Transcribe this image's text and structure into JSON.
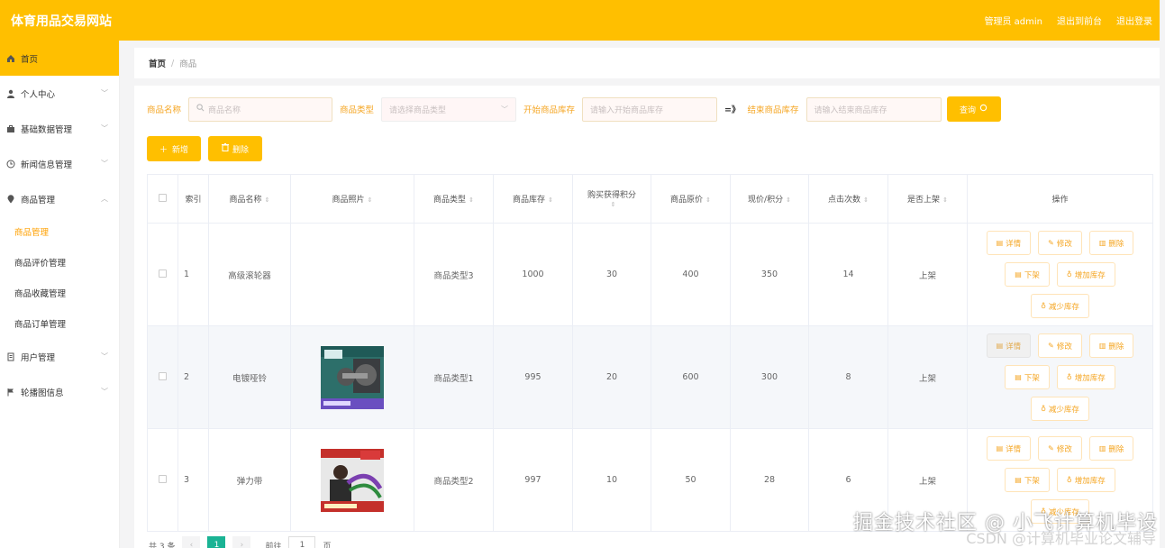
{
  "header": {
    "title": "体育用品交易网站",
    "admin_label": "管理员 admin",
    "back_label": "退出到前台",
    "logout_label": "退出登录"
  },
  "sidebar": {
    "items": [
      {
        "label": "首页",
        "icon": "home-icon"
      },
      {
        "label": "个人中心",
        "icon": "user-icon"
      },
      {
        "label": "基础数据管理",
        "icon": "briefcase-icon"
      },
      {
        "label": "新闻信息管理",
        "icon": "clock-icon"
      },
      {
        "label": "商品管理",
        "icon": "location-icon"
      },
      {
        "label": "用户管理",
        "icon": "document-icon"
      },
      {
        "label": "轮播图信息",
        "icon": "flag-icon"
      }
    ],
    "sub_items": [
      "商品管理",
      "商品评价管理",
      "商品收藏管理",
      "商品订单管理"
    ]
  },
  "breadcrumb": {
    "home": "首页",
    "sep": "/",
    "current": "商品"
  },
  "search": {
    "name_label": "商品名称",
    "name_placeholder": "商品名称",
    "type_label": "商品类型",
    "type_placeholder": "请选择商品类型",
    "stock_start_label": "开始商品库存",
    "stock_start_placeholder": "请输入开始商品库存",
    "arrow": "=》",
    "stock_end_label": "结束商品库存",
    "stock_end_placeholder": "请输入结束商品库存",
    "query_label": "查询"
  },
  "actions": {
    "add_label": "新增",
    "delete_label": "删除"
  },
  "table": {
    "headers": [
      "索引",
      "商品名称",
      "商品照片",
      "商品类型",
      "商品库存",
      "购买获得积分",
      "商品原价",
      "现价/积分",
      "点击次数",
      "是否上架",
      "操作"
    ],
    "rows": [
      {
        "index": "1",
        "name": "高级滚轮器",
        "type": "商品类型3",
        "stock": "1000",
        "points": "30",
        "orig_price": "400",
        "price": "350",
        "clicks": "14",
        "onsale": "上架"
      },
      {
        "index": "2",
        "name": "电镀哑铃",
        "type": "商品类型1",
        "stock": "995",
        "points": "20",
        "orig_price": "600",
        "price": "300",
        "clicks": "8",
        "onsale": "上架"
      },
      {
        "index": "3",
        "name": "弹力带",
        "type": "商品类型2",
        "stock": "997",
        "points": "10",
        "orig_price": "50",
        "price": "28",
        "clicks": "6",
        "onsale": "上架"
      }
    ],
    "ops": {
      "detail": "详情",
      "edit": "修改",
      "delete": "删除",
      "offshelf": "下架",
      "add_stock": "增加库存",
      "reduce_stock": "减少库存"
    }
  },
  "pager": {
    "total": "共 3 条",
    "current": "1",
    "goto_label": "前往",
    "goto_value": "1",
    "page_unit": "页"
  },
  "watermark": {
    "line1": "掘金技术社区 @ 小飞计算机毕设",
    "line2": "CSDN @计算机毕业论文辅导"
  },
  "colors": {
    "accent": "#ffbf00",
    "link": "#f5a623",
    "pager_active": "#1ab394"
  }
}
